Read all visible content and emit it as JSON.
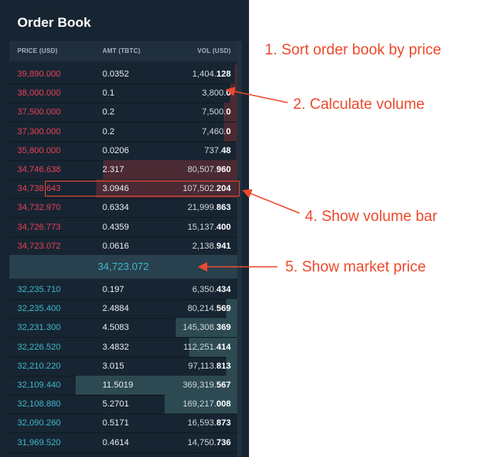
{
  "panel": {
    "title": "Order Book",
    "headers": {
      "price": "PRICE (USD)",
      "amt": "AMT (TBTC)",
      "vol": "VOL (USD)"
    }
  },
  "asks": [
    {
      "price": "39,890.000",
      "amt": "0.0352",
      "vol_main": "1,404.",
      "vol_dec": "128",
      "fill": 0.01
    },
    {
      "price": "38,000.000",
      "amt": "0.1",
      "vol_main": "3,800.",
      "vol_dec": "0",
      "fill": 0.03
    },
    {
      "price": "37,500.000",
      "amt": "0.2",
      "vol_main": "7,500.",
      "vol_dec": "0",
      "fill": 0.06
    },
    {
      "price": "37,300.000",
      "amt": "0.2",
      "vol_main": "7,460.",
      "vol_dec": "0",
      "fill": 0.06
    },
    {
      "price": "35,800.000",
      "amt": "0.0206",
      "vol_main": "737.",
      "vol_dec": "48",
      "fill": 0.005
    },
    {
      "price": "34,746.638",
      "amt": "2.317",
      "vol_main": "80,507.",
      "vol_dec": "960",
      "fill": 0.59
    },
    {
      "price": "34,738.643",
      "amt": "3.0946",
      "vol_main": "107,502.",
      "vol_dec": "204",
      "fill": 0.62
    },
    {
      "price": "34,732.970",
      "amt": "0.6334",
      "vol_main": "21,999.",
      "vol_dec": "863",
      "fill": 0.0
    },
    {
      "price": "34,726.773",
      "amt": "0.4359",
      "vol_main": "15,137.",
      "vol_dec": "400",
      "fill": 0.0
    },
    {
      "price": "34,723.072",
      "amt": "0.0616",
      "vol_main": "2,138.",
      "vol_dec": "941",
      "fill": 0.0
    }
  ],
  "market_price": "34,723.072",
  "bids": [
    {
      "price": "32,235.710",
      "amt": "0.197",
      "vol_main": "6,350.",
      "vol_dec": "434",
      "fill": 0.0
    },
    {
      "price": "32,235.400",
      "amt": "2.4884",
      "vol_main": "80,214.",
      "vol_dec": "569",
      "fill": 0.05
    },
    {
      "price": "32,231.300",
      "amt": "4.5083",
      "vol_main": "145,308.",
      "vol_dec": "369",
      "fill": 0.27
    },
    {
      "price": "32,226.520",
      "amt": "3.4832",
      "vol_main": "112,251.",
      "vol_dec": "414",
      "fill": 0.21
    },
    {
      "price": "32,210.220",
      "amt": "3.015",
      "vol_main": "97,113.",
      "vol_dec": "813",
      "fill": 0.05
    },
    {
      "price": "32,109.440",
      "amt": "11.5019",
      "vol_main": "369,319.",
      "vol_dec": "567",
      "fill": 0.71
    },
    {
      "price": "32,108.880",
      "amt": "5.2701",
      "vol_main": "169,217.",
      "vol_dec": "008",
      "fill": 0.32
    },
    {
      "price": "32,090.260",
      "amt": "0.5171",
      "vol_main": "16,593.",
      "vol_dec": "873",
      "fill": 0.0
    },
    {
      "price": "31,969.520",
      "amt": "0.4614",
      "vol_main": "14,750.",
      "vol_dec": "736",
      "fill": 0.0
    }
  ],
  "annotations": {
    "a1": "1. Sort order book by price",
    "a2": "2. Calculate volume",
    "a4": "4. Show volume bar",
    "a5": "5. Show market price"
  },
  "colors": {
    "ask": "#e84058",
    "bid": "#3fb8c9",
    "annotation": "#ec4a2c"
  }
}
